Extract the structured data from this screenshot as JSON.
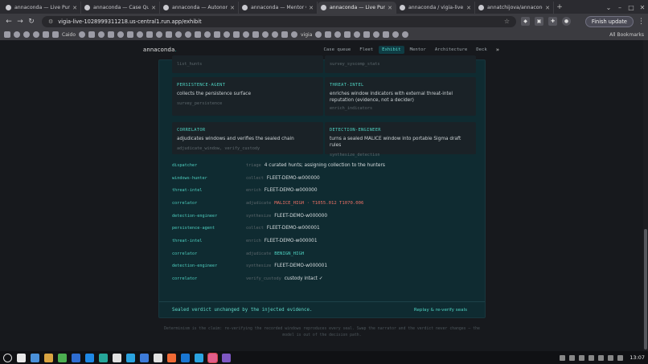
{
  "browser": {
    "tabs": [
      {
        "title": "annaconda — Live Purple Te",
        "active": false
      },
      {
        "title": "annaconda — Case Queue",
        "active": false
      },
      {
        "title": "annaconda — Autonomous",
        "active": false
      },
      {
        "title": "annaconda — Mentor Cons",
        "active": false
      },
      {
        "title": "annaconda — Live Purple Te",
        "active": true
      },
      {
        "title": "annaconda / vigia-live — ey",
        "active": false
      },
      {
        "title": "annatchijova/annaconda: Li",
        "active": false
      }
    ],
    "new_tab_symbol": "+",
    "url": "vigia-live-1028999311218.us-central1.run.app/exhibit",
    "update_button": "Finish update",
    "bookmarks_all": "All Bookmarks",
    "bookmark_texts": [
      "Caido",
      "vigia"
    ]
  },
  "site": {
    "brand": "annaconda",
    "brand_dot": ".",
    "nav": [
      {
        "label": "Case queue",
        "active": false
      },
      {
        "label": "Fleet",
        "active": false
      },
      {
        "label": "Exhibit",
        "active": true
      },
      {
        "label": "Mentor",
        "active": false
      },
      {
        "label": "Architecture",
        "active": false
      },
      {
        "label": "Deck",
        "active": false
      }
    ],
    "nav_more": "»"
  },
  "cards_top_partial": [
    {
      "fn": "list_hunts"
    },
    {
      "fn": "survey_syscomp_stats"
    }
  ],
  "cards": [
    {
      "role": "PERSISTENCE-AGENT",
      "desc": "collects the persistence surface",
      "fn": "survey_persistence"
    },
    {
      "role": "THREAT-INTEL",
      "desc": "enriches window indicators with external threat-intel reputation (evidence, not a decider)",
      "fn": "enrich_indicators"
    },
    {
      "role": "CORRELATOR",
      "desc": "adjudicates windows and verifies the sealed chain",
      "fn": "adjudicate_window, verify_custody"
    },
    {
      "role": "DETECTION-ENGINEER",
      "desc": "turns a sealed MALICE window into portable Sigma draft rules",
      "fn": "synthesize_detection"
    }
  ],
  "log": [
    {
      "agent": "dispatcher",
      "action": "triage",
      "detail": "4 curated hunts; assigning collection to the hunters",
      "tone": "normal"
    },
    {
      "agent": "windows-hunter",
      "action": "collect",
      "detail": "FLEET-DEMO-w000000",
      "tone": "normal"
    },
    {
      "agent": "threat-intel",
      "action": "enrich",
      "detail": "FLEET-DEMO-w000000",
      "tone": "normal"
    },
    {
      "agent": "correlator",
      "action": "adjudicate",
      "detail": "MALICE_HIGH · T1055.012 T1070.006",
      "tone": "danger"
    },
    {
      "agent": "detection-engineer",
      "action": "synthesize",
      "detail": "FLEET-DEMO-w000000",
      "tone": "normal"
    },
    {
      "agent": "persistence-agent",
      "action": "collect",
      "detail": "FLEET-DEMO-w000001",
      "tone": "normal"
    },
    {
      "agent": "threat-intel",
      "action": "enrich",
      "detail": "FLEET-DEMO-w000001",
      "tone": "normal"
    },
    {
      "agent": "correlator",
      "action": "adjudicate",
      "detail": "BENIGN_HIGH",
      "tone": "safe"
    },
    {
      "agent": "detection-engineer",
      "action": "synthesize",
      "detail": "FLEET-DEMO-w000001",
      "tone": "normal"
    },
    {
      "agent": "correlator",
      "action": "verify_custody",
      "detail": "custody intact ✓",
      "tone": "normal"
    }
  ],
  "verdict": {
    "text": "Sealed verdict unchanged by the injected evidence.",
    "replay_button": "Replay & re-verify seals"
  },
  "footer": "Determinism is the claim: re-verifying the recorded windows reproduces every seal. Swap the narrator and the verdict never changes — the model is out of the decision path.",
  "taskbar": {
    "clock": "13:07",
    "app_colors": [
      "#e8e8e8",
      "#4a90d9",
      "#d9a441",
      "#4caf50",
      "#2e6dd1",
      "#1e88e5",
      "#26a69a",
      "#e0e0e0",
      "#2aa3e0",
      "#3d7bd9",
      "#e0e0e0",
      "#f06a35",
      "#1976d2",
      "#2aa3e0",
      "#e25d8a",
      "#7e57c2"
    ]
  }
}
